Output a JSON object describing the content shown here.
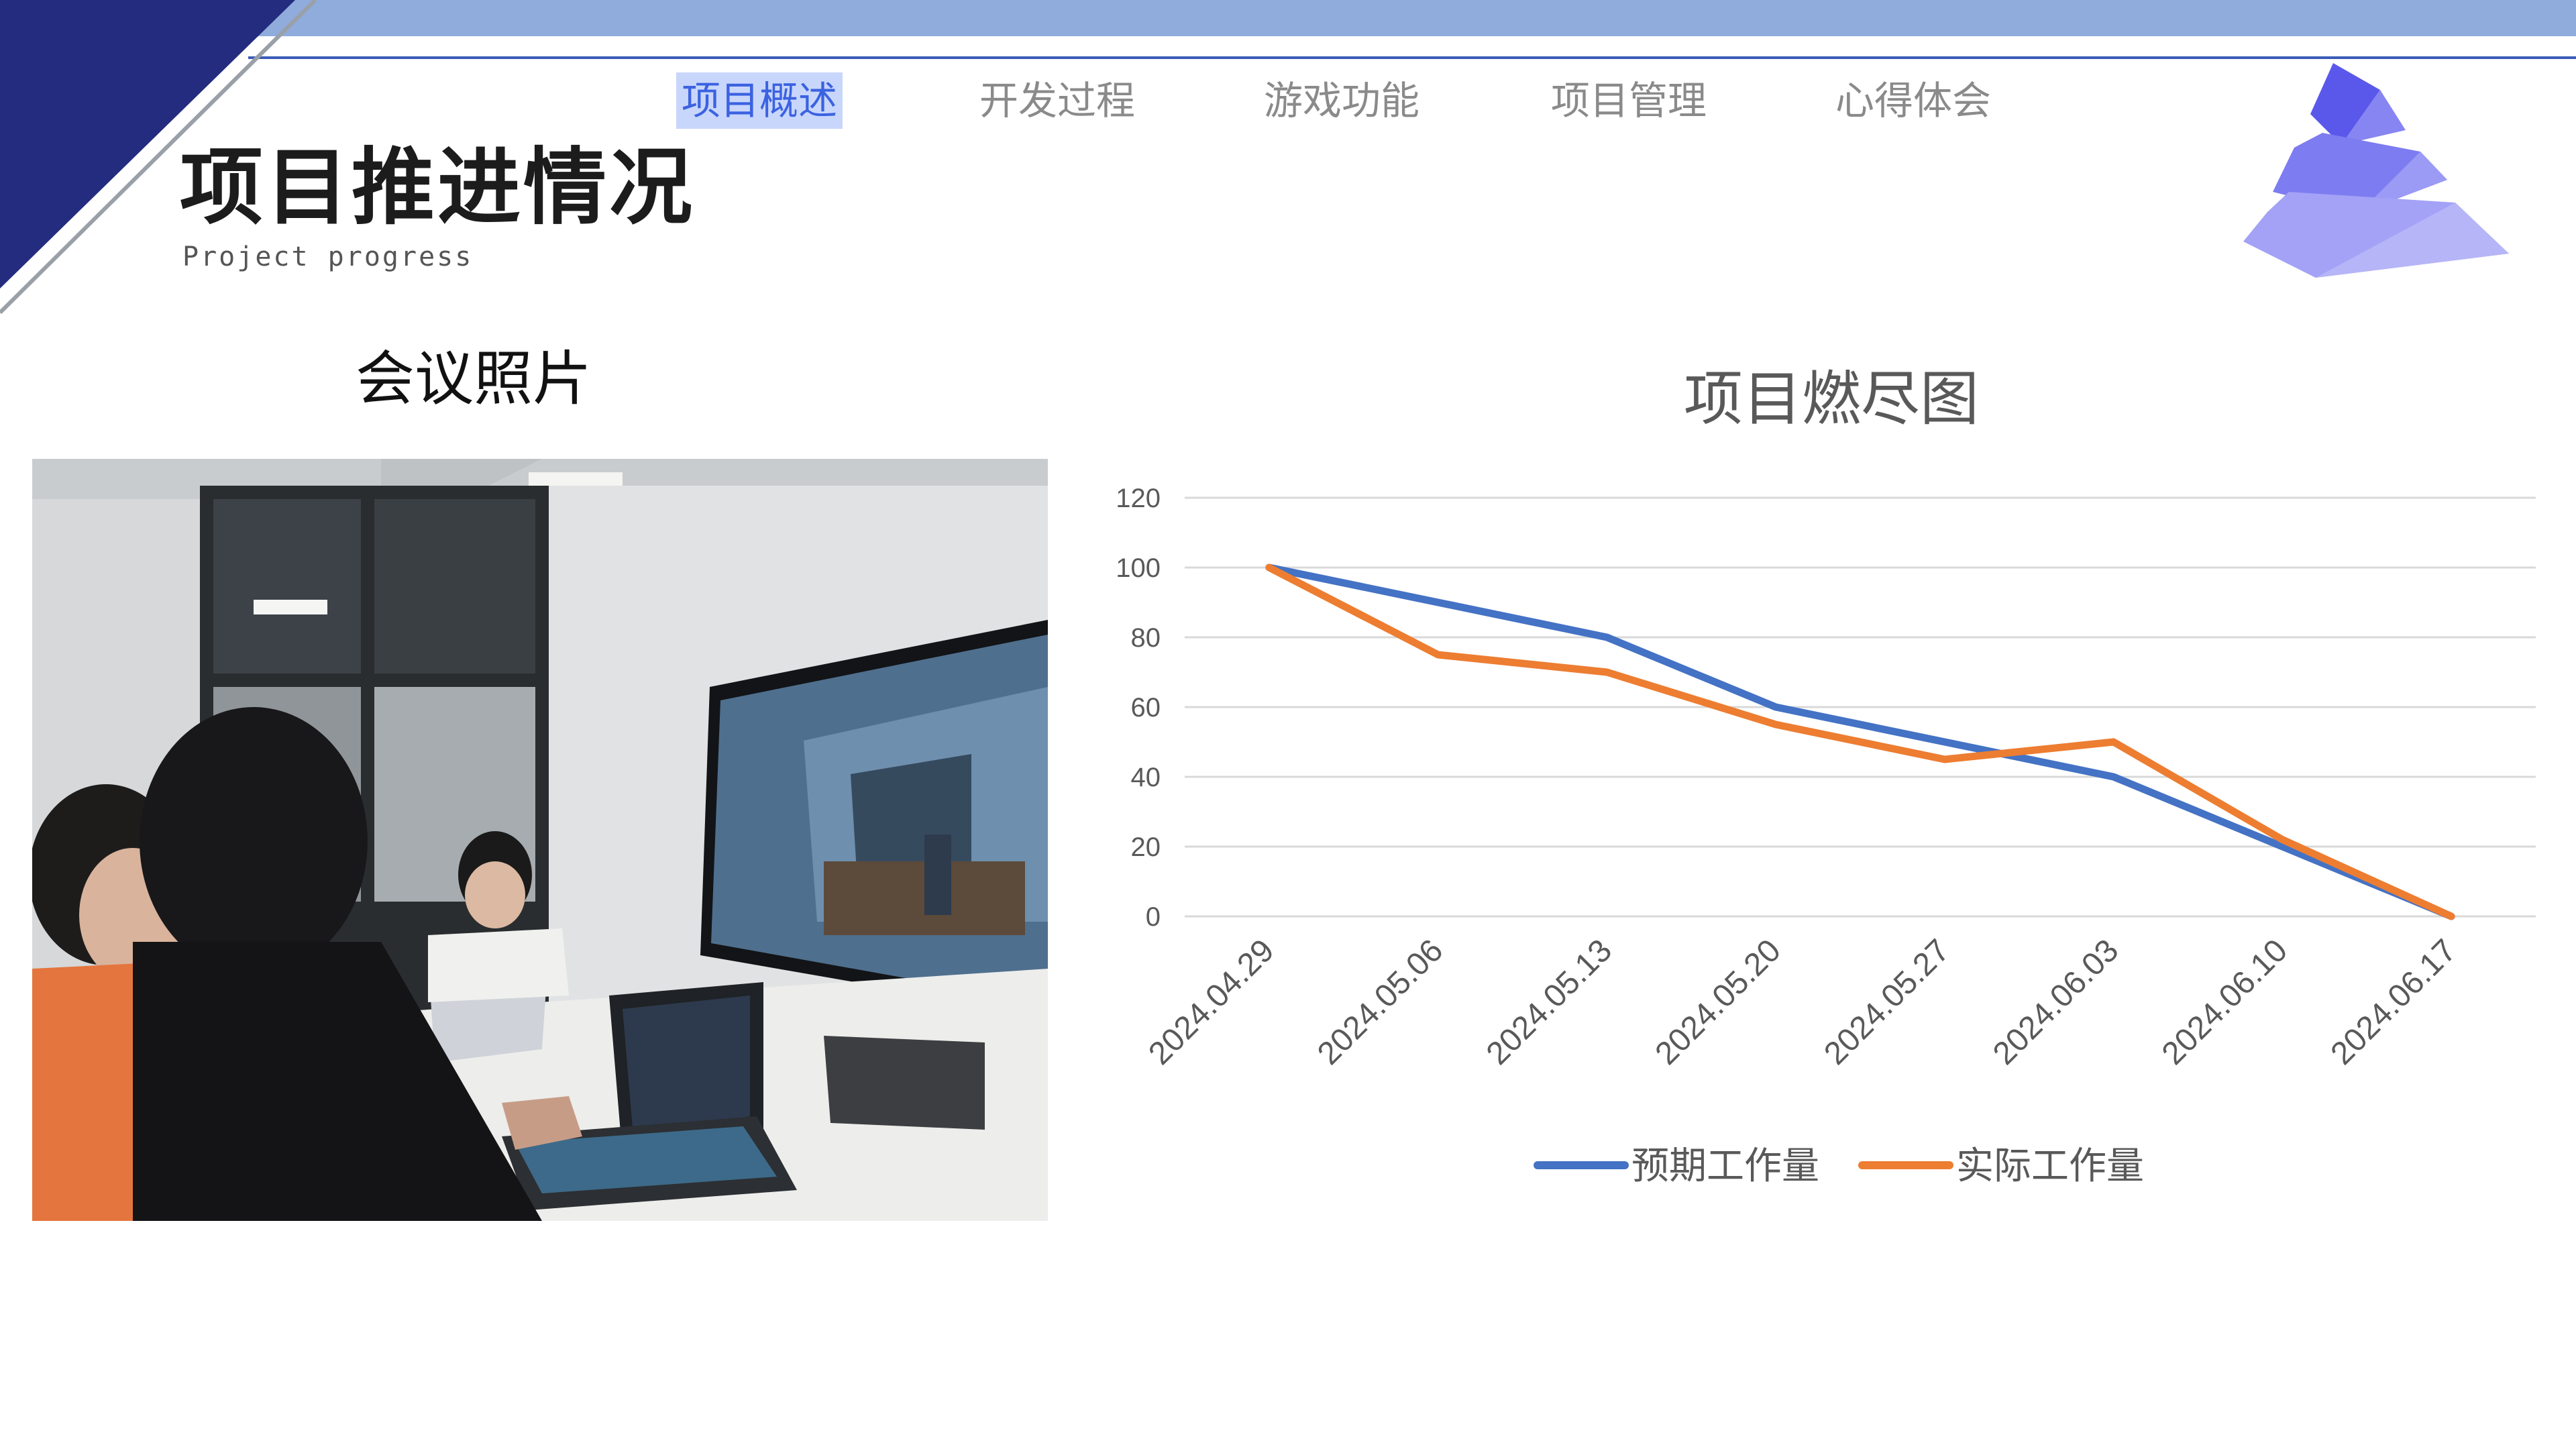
{
  "nav": {
    "items": [
      {
        "label": "项目概述",
        "active": true
      },
      {
        "label": "开发过程",
        "active": false
      },
      {
        "label": "游戏功能",
        "active": false
      },
      {
        "label": "项目管理",
        "active": false
      },
      {
        "label": "心得体会",
        "active": false
      }
    ]
  },
  "header": {
    "title": "项目推进情况",
    "subtitle": "Project progress"
  },
  "photo": {
    "caption": "会议照片"
  },
  "colors": {
    "deco_navy": "#232c7e",
    "deco_band": "#8facdc",
    "deco_line": "#3b5db8",
    "pyramid_top": "#6f6ef0",
    "pyramid_mid": "#8a8af3",
    "pyramid_bottom": "#a9a9f7",
    "nav_active_bg": "#c8d6fb",
    "nav_active_text": "#3b62e0",
    "series_expected": "#4472c4",
    "series_actual": "#ed7d31"
  },
  "decor_icons": [
    "triangle-corner-icon",
    "pyramid-icon"
  ],
  "chart_data": {
    "type": "line",
    "title": "项目燃尽图",
    "categories": [
      "2024.04.29",
      "2024.05.06",
      "2024.05.13",
      "2024.05.20",
      "2024.05.27",
      "2024.06.03",
      "2024.06.10",
      "2024.06.17"
    ],
    "series": [
      {
        "name": "预期工作量",
        "color": "#4472c4",
        "values": [
          100,
          90,
          80,
          60,
          50,
          40,
          20,
          0
        ]
      },
      {
        "name": "实际工作量",
        "color": "#ed7d31",
        "values": [
          100,
          75,
          70,
          55,
          45,
          50,
          22,
          0
        ]
      }
    ],
    "yticks": [
      0,
      20,
      40,
      60,
      80,
      100,
      120
    ],
    "ylim": [
      0,
      120
    ],
    "grid": true,
    "legend_position": "bottom"
  }
}
